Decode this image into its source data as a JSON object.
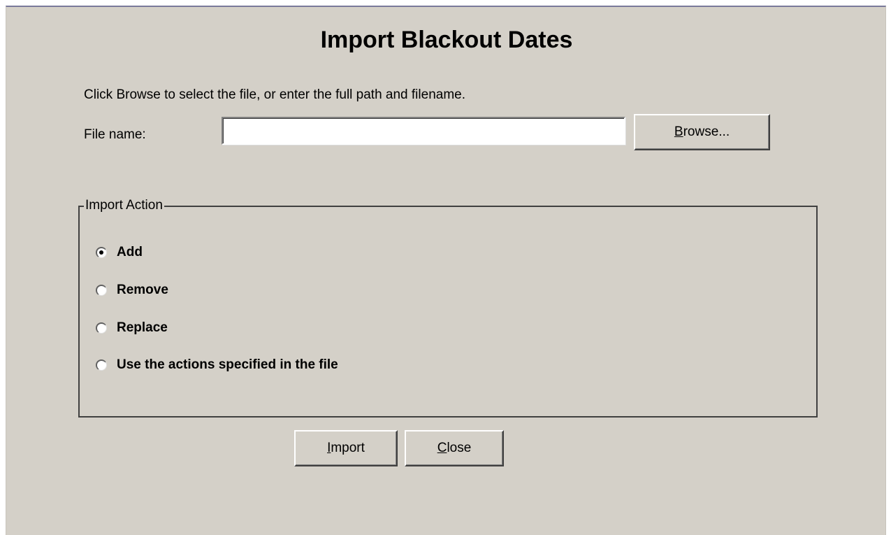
{
  "dialog": {
    "title": "Import Blackout Dates",
    "instructions": "Click Browse to select the file, or enter the full path and filename.",
    "file_name": {
      "label": "File name:",
      "value": "",
      "placeholder": ""
    },
    "browse_button": {
      "mnemonic": "B",
      "rest": "rowse..."
    },
    "import_action": {
      "legend": "Import Action",
      "options": [
        {
          "label": "Add",
          "checked": true
        },
        {
          "label": "Remove",
          "checked": false
        },
        {
          "label": "Replace",
          "checked": false
        },
        {
          "label": "Use the actions specified in the file",
          "checked": false
        }
      ]
    },
    "import_button": {
      "mnemonic": "I",
      "rest": "mport"
    },
    "close_button": {
      "mnemonic": "C",
      "rest": "lose"
    }
  },
  "colors": {
    "dialog_background": "#d4d0c8",
    "input_background": "#ffffff",
    "text": "#000000"
  }
}
